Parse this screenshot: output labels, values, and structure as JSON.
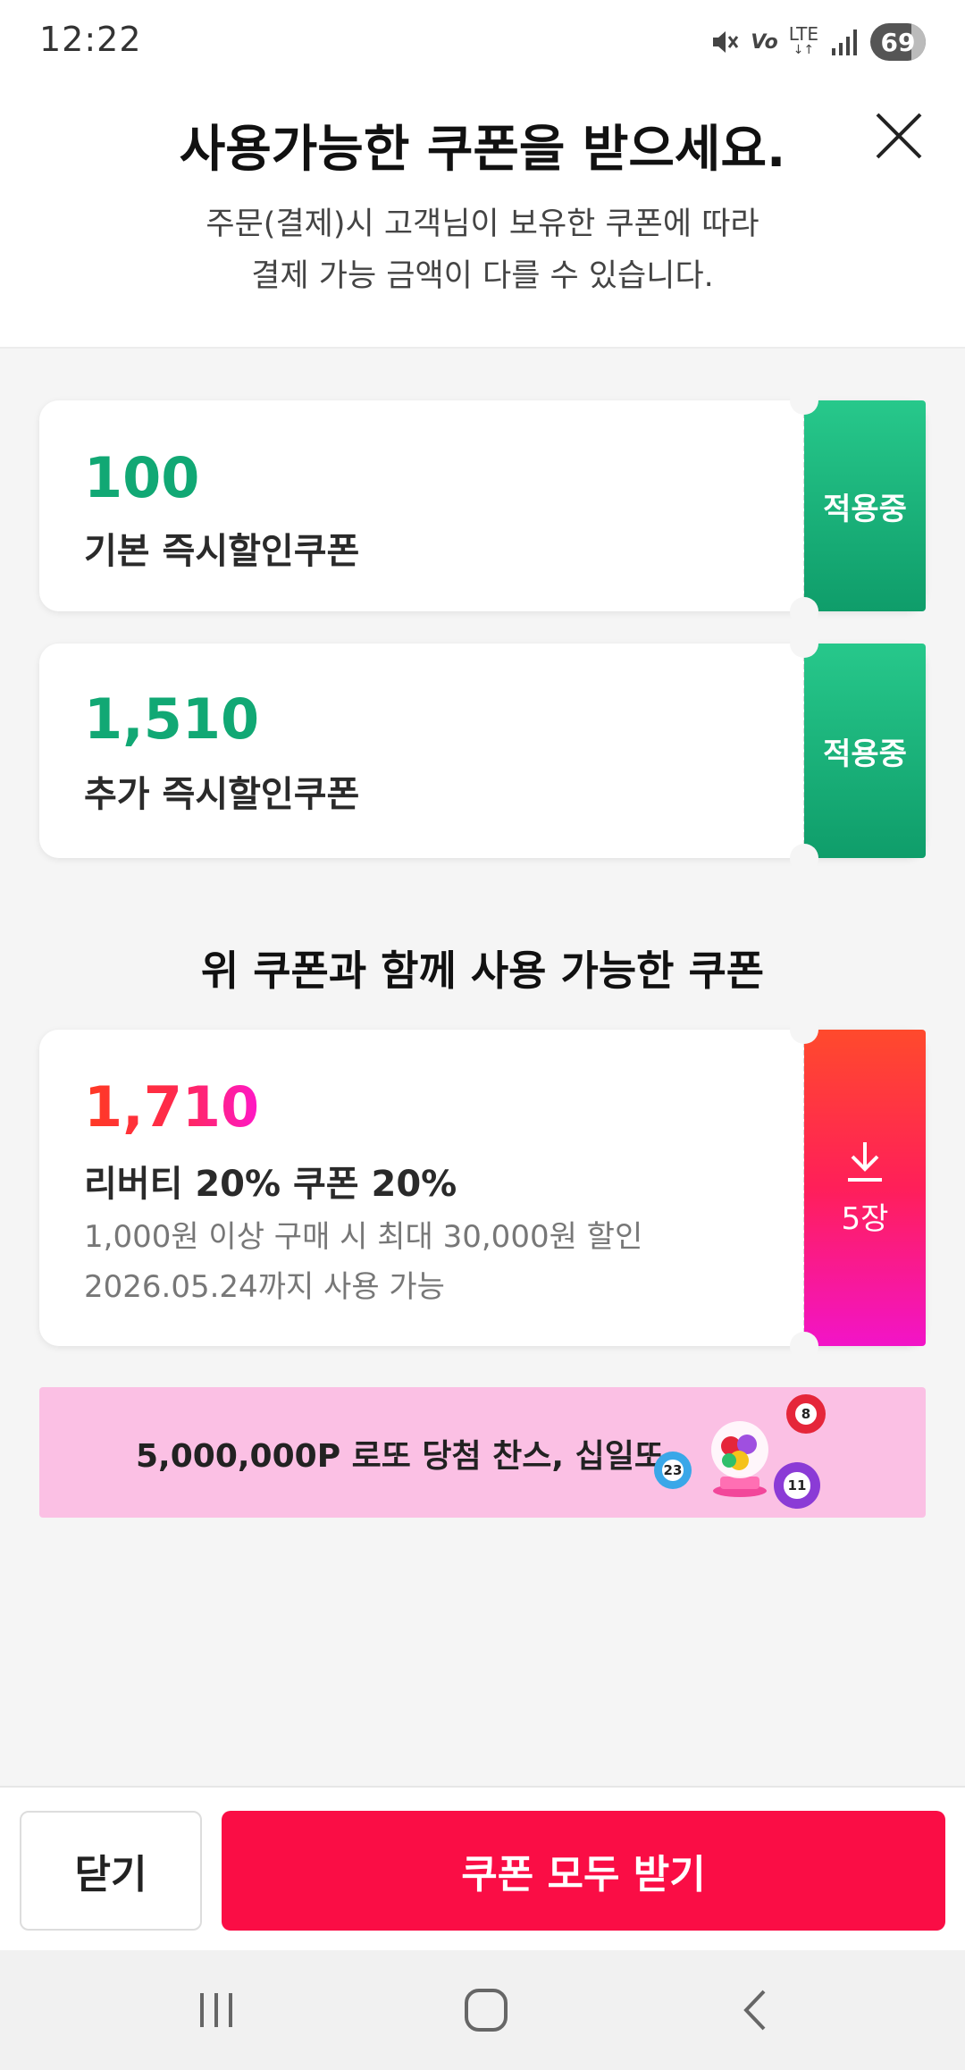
{
  "status_bar": {
    "time": "12:22",
    "icons": [
      "mute-icon",
      "volte-icon",
      "lte-icon",
      "signal-icon"
    ],
    "volte_label": "Vo",
    "lte_label": "LTE",
    "battery": "69"
  },
  "header": {
    "title": "사용가능한 쿠폰을 받으세요.",
    "subtitle_line1": "주문(결제)시 고객님이 보유한 쿠폰에 따라",
    "subtitle_line2": "결제 가능 금액이 다를 수 있습니다."
  },
  "applied_coupons": [
    {
      "amount": "100",
      "name": "기본 즉시할인쿠폰",
      "status": "적용중"
    },
    {
      "amount": "1,510",
      "name": "추가 즉시할인쿠폰",
      "status": "적용중"
    }
  ],
  "section_title": "위 쿠폰과 함께 사용 가능한 쿠폰",
  "available_coupon": {
    "amount": "1,710",
    "name": "리버티 20% 쿠폰 20%",
    "condition": "1,000원 이상 구매 시 최대 30,000원 할인",
    "validity": "2026.05.24까지 사용 가능",
    "count": "5장"
  },
  "banner": {
    "text": "5,000,000P 로또 당첨 찬스, 십일또",
    "balls": [
      "8",
      "23",
      "11"
    ]
  },
  "footer": {
    "close_label": "닫기",
    "download_all_label": "쿠폰 모두 받기"
  },
  "colors": {
    "accent_red": "#fa0d45",
    "applied_green": "#11a874",
    "banner_pink": "#fbc0e4"
  }
}
